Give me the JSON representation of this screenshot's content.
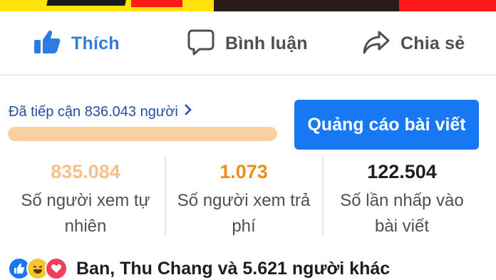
{
  "actions": {
    "like_label": "Thích",
    "comment_label": "Bình luận",
    "share_label": "Chia sẻ"
  },
  "reach": {
    "text": "Đã tiếp cận 836.043 người",
    "bar_color": "#f9cfa3"
  },
  "boost_button": {
    "label": "Quảng cáo bài viết",
    "color": "#1877f2"
  },
  "stats": [
    {
      "value": "835.084",
      "label_line1": "Số người xem tự",
      "label_line2": "nhiên",
      "color": "#f7c08a"
    },
    {
      "value": "1.073",
      "label_line1": "Số người xem trả",
      "label_line2": "phí",
      "color": "#f08c1c"
    },
    {
      "value": "122.504",
      "label_line1": "Số lần nhấp vào",
      "label_line2": "bài viết",
      "color": "#1c1e21"
    }
  ],
  "reactions": {
    "icons": [
      "like-icon",
      "haha-icon",
      "love-icon"
    ],
    "summary": "Ban, Thu Chang và 5.621 người khác"
  }
}
